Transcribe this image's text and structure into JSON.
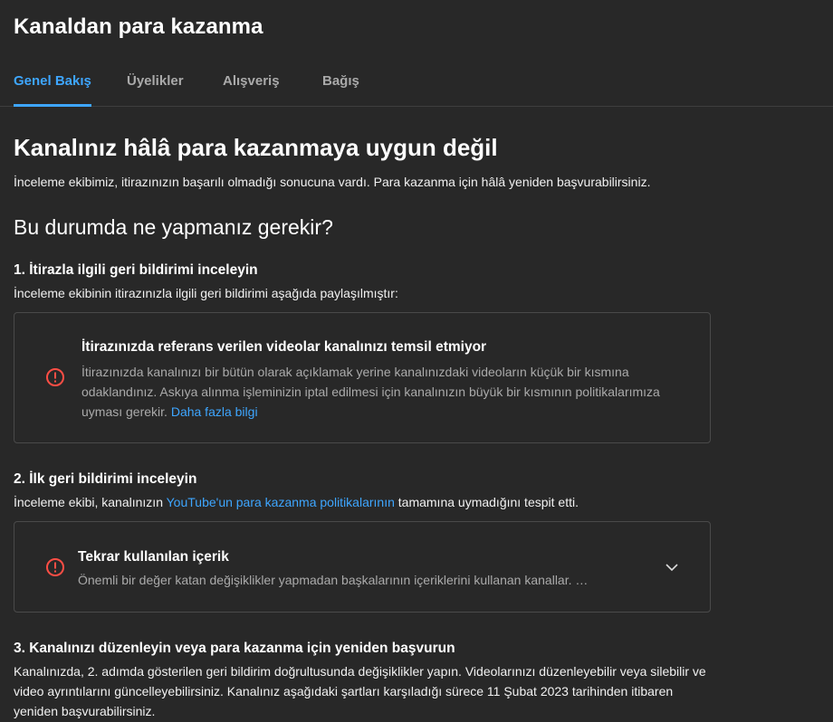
{
  "page": {
    "title": "Kanaldan para kazanma"
  },
  "tabs": [
    {
      "label": "Genel Bakış",
      "active": true
    },
    {
      "label": "Üyelikler",
      "active": false
    },
    {
      "label": "Alışveriş",
      "active": false
    },
    {
      "label": "Bağış",
      "active": false
    }
  ],
  "status": {
    "heading": "Kanalınız hâlâ para kazanmaya uygun değil",
    "message": "İnceleme ekibimiz, itirazınızın başarılı olmadığı sonucuna vardı. Para kazanma için hâlâ yeniden başvurabilirsiniz."
  },
  "next_steps": {
    "heading": "Bu durumda ne yapmanız gerekir?",
    "step1": {
      "title": "1. İtirazla ilgili geri bildirimi inceleyin",
      "desc": "İnceleme ekibinin itirazınızla ilgili geri bildirimi aşağıda paylaşılmıştır:",
      "card": {
        "icon": "alert-circle-icon",
        "title": "İtirazınızda referans verilen videolar kanalınızı temsil etmiyor",
        "body": "İtirazınızda kanalınızı bir bütün olarak açıklamak yerine kanalınızdaki videoların küçük bir kısmına odaklandınız. Askıya alınma işleminizin iptal edilmesi için kanalınızın büyük bir kısmının politikalarımıza uyması gerekir.",
        "link": "Daha fazla bilgi"
      }
    },
    "step2": {
      "title": "2. İlk geri bildirimi inceleyin",
      "desc_before": "İnceleme ekibi, kanalınızın ",
      "desc_link": "YouTube'un para kazanma politikalarının",
      "desc_after": " tamamına uymadığını tespit etti.",
      "card": {
        "icon": "alert-circle-icon",
        "title": "Tekrar kullanılan içerik",
        "body": "Önemli bir değer katan değişiklikler yapmadan başkalarının içeriklerini kullanan kanallar. …",
        "expand_icon": "chevron-down-icon"
      }
    },
    "step3": {
      "title": "3. Kanalınızı düzenleyin veya para kazanma için yeniden başvurun",
      "body": "Kanalınızda, 2. adımda gösterilen geri bildirim doğrultusunda değişiklikler yapın. Videolarınızı düzenleyebilir veya silebilir ve video ayrıntılarını güncelleyebilirsiniz. Kanalınız aşağıdaki şartları karşıladığı sürece 11 Şubat 2023 tarihinden itibaren yeniden başvurabilirsiniz."
    }
  },
  "colors": {
    "accent": "#3ea6ff",
    "alert": "#ff4e45",
    "background": "#282828",
    "secondary_text": "#aaaaaa"
  }
}
